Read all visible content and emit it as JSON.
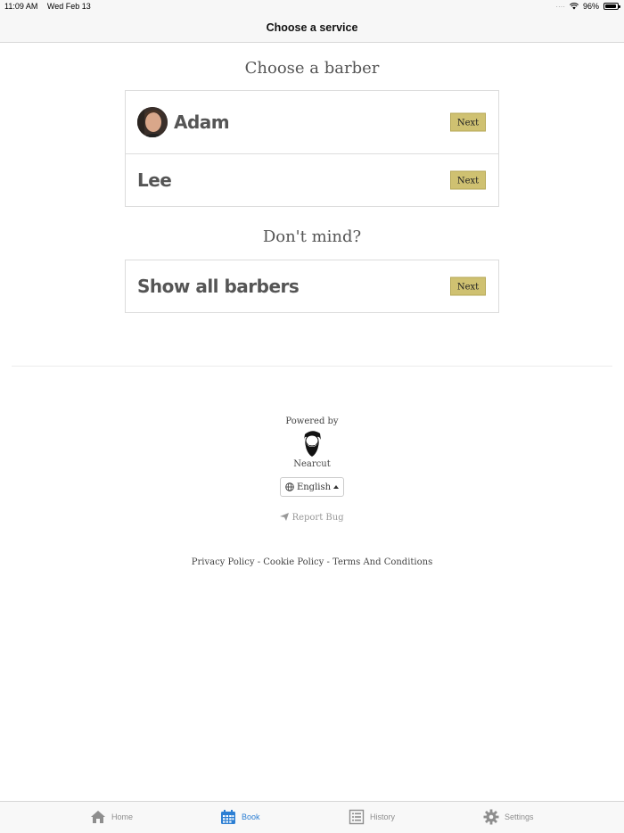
{
  "status_bar": {
    "time": "11:09 AM",
    "date": "Wed Feb 13",
    "battery": "96%",
    "battery_level": 0.96
  },
  "nav": {
    "title": "Choose a service"
  },
  "barbers_section": {
    "heading": "Choose a barber",
    "barbers": [
      {
        "name": "Adam",
        "has_avatar": true,
        "button": "Next"
      },
      {
        "name": "Lee",
        "has_avatar": false,
        "button": "Next"
      }
    ]
  },
  "any_section": {
    "heading": "Don't mind?",
    "option": {
      "name": "Show all barbers",
      "button": "Next"
    }
  },
  "footer": {
    "powered_by": "Powered by",
    "brand": "Nearcut",
    "language": "English",
    "report_bug": "Report Bug",
    "links": [
      "Privacy Policy",
      "Cookie Policy",
      "Terms And Conditions"
    ],
    "link_separator": " - "
  },
  "tabbar": {
    "items": [
      {
        "label": "Home",
        "icon": "home-icon",
        "active": false
      },
      {
        "label": "Book",
        "icon": "calendar-icon",
        "active": true
      },
      {
        "label": "History",
        "icon": "list-icon",
        "active": false
      },
      {
        "label": "Settings",
        "icon": "gear-icon",
        "active": false
      }
    ]
  },
  "colors": {
    "accent": "#2d7fd3",
    "button": "#cfc171"
  }
}
